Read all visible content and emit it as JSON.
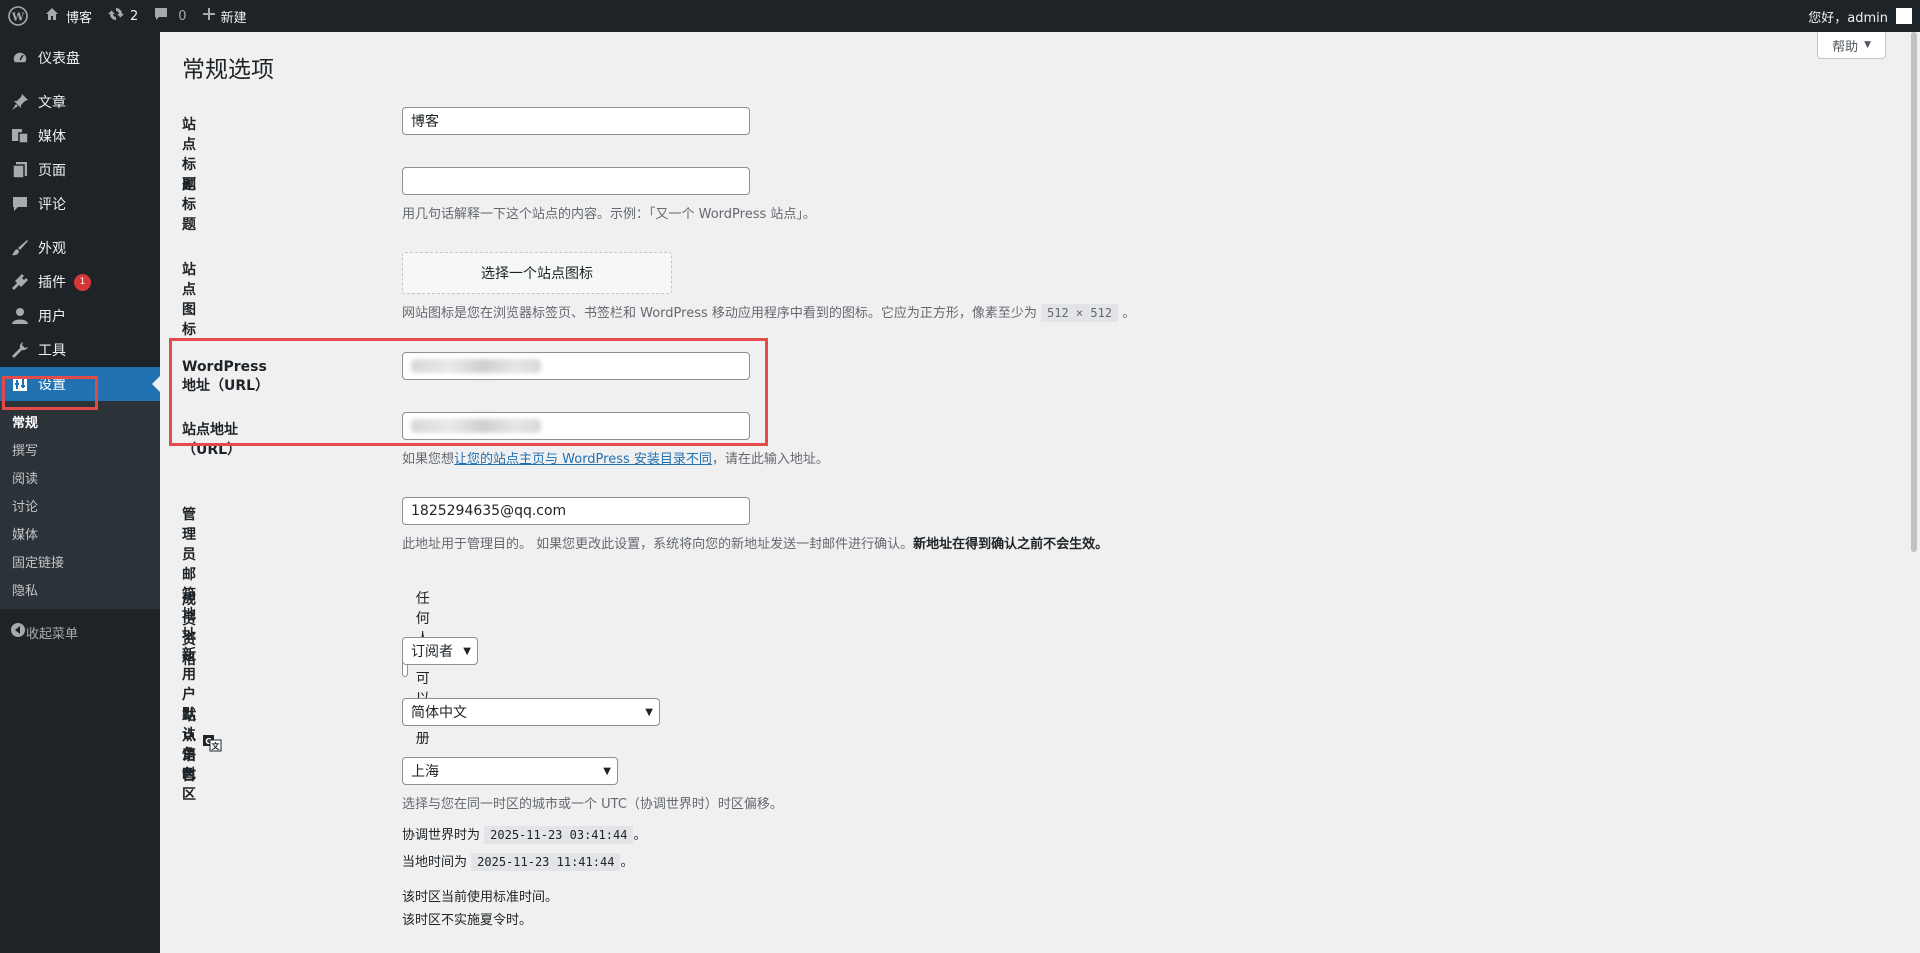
{
  "adminbar": {
    "wp_logo": "wordpress-icon",
    "site_name": "博客",
    "updates_count": "2",
    "comments_count": "0",
    "new_label": "新建",
    "greeting": "您好，admin"
  },
  "sidebar": {
    "items": [
      {
        "label": "仪表盘",
        "icon": "dashboard-icon"
      },
      {
        "label": "文章",
        "icon": "pin-icon"
      },
      {
        "label": "媒体",
        "icon": "media-icon"
      },
      {
        "label": "页面",
        "icon": "page-icon"
      },
      {
        "label": "评论",
        "icon": "comment-icon"
      },
      {
        "label": "外观",
        "icon": "brush-icon"
      },
      {
        "label": "插件",
        "icon": "plugin-icon",
        "badge": "1"
      },
      {
        "label": "用户",
        "icon": "user-icon"
      },
      {
        "label": "工具",
        "icon": "wrench-icon"
      },
      {
        "label": "设置",
        "icon": "settings-icon"
      }
    ],
    "submenu": [
      "常规",
      "撰写",
      "阅读",
      "讨论",
      "媒体",
      "固定链接",
      "隐私"
    ],
    "collapse_label": "收起菜单"
  },
  "page": {
    "help_label": "帮助",
    "title": "常规选项",
    "site_title_label": "站点标题",
    "site_title_value": "博客",
    "tagline_label": "副标题",
    "tagline_value": "",
    "tagline_desc": "用几句话解释一下这个站点的内容。示例：「又一个 WordPress 站点」。",
    "site_icon_label": "站点图标",
    "site_icon_button": "选择一个站点图标",
    "site_icon_desc_before": "网站图标是您在浏览器标签页、书签栏和 WordPress 移动应用程序中看到的图标。它应为正方形，像素至少为 ",
    "site_icon_size": "512 × 512",
    "site_icon_desc_after": " 。",
    "wp_url_label": "WordPress 地址（URL）",
    "site_url_label": "站点地址（URL）",
    "site_url_desc_before": "如果您想",
    "site_url_desc_link": "让您的站点主页与 WordPress 安装目录不同",
    "site_url_desc_after": "，请在此输入地址。",
    "admin_email_label": "管理员邮箱地址",
    "admin_email_value": "1825294635@qq.com",
    "admin_email_desc": "此地址用于管理目的。 如果您更改此设置，系统将向您的新地址发送一封邮件进行确认。",
    "admin_email_desc_bold": "新地址在得到确认之前不会生效。",
    "membership_label": "成员资格",
    "membership_checkbox": "任何人都可以注册",
    "default_role_label": "新用户默认角色",
    "default_role_value": "订阅者",
    "language_label": "站点语言",
    "language_value": "简体中文",
    "timezone_label": "时区",
    "timezone_value": "上海",
    "timezone_desc": "选择与您在同一时区的城市或一个 UTC（协调世界时）时区偏移。",
    "utc_label": "协调世界时为",
    "utc_value": "2025-11-23 03:41:44",
    "local_label": "当地时间为",
    "local_value": "2025-11-23 11:41:44",
    "period_1": "。",
    "period_2": "。",
    "dst_note_1": "该时区当前使用标准时间。",
    "dst_note_2": "该时区不实施夏令时。"
  },
  "colors": {
    "accent": "#2271b1",
    "sidebar_bg": "#1d2327",
    "highlight": "#e34b4b",
    "badge": "#d63638"
  }
}
